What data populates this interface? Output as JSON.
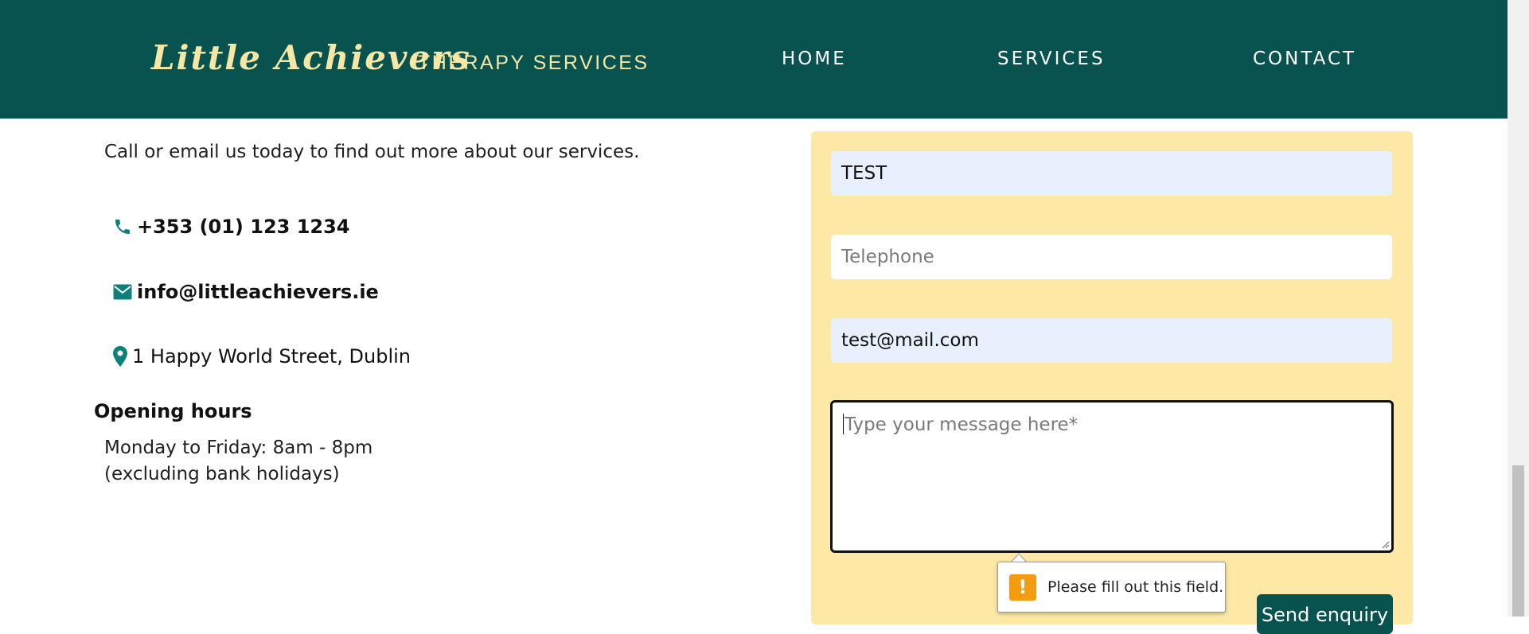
{
  "header": {
    "brand_name": "Little Achievers",
    "brand_tagline": "THERAPY SERVICES",
    "nav": [
      {
        "label": "HOME"
      },
      {
        "label": "SERVICES"
      },
      {
        "label": "CONTACT"
      }
    ]
  },
  "contact_info": {
    "intro": "Call or email us today to find out more about our services.",
    "phone": {
      "icon": "phone-icon",
      "text": "+353 (01) 123 1234"
    },
    "email": {
      "icon": "envelope-icon",
      "text": "info@littleachievers.ie"
    },
    "address": {
      "icon": "map-pin-icon",
      "text": "1 Happy World Street, Dublin"
    },
    "hours_heading": "Opening hours",
    "hours_line1": "Monday to Friday: 8am - 8pm",
    "hours_line2": "(excluding bank holidays)"
  },
  "form": {
    "name": {
      "value": "TEST",
      "placeholder": ""
    },
    "telephone": {
      "value": "",
      "placeholder": "Telephone"
    },
    "email": {
      "value": "test@mail.com",
      "placeholder": ""
    },
    "message": {
      "value": "",
      "placeholder": "Type your message here*"
    },
    "submit_label": "Send enquiry",
    "validation_message": "Please fill out this field."
  },
  "colors": {
    "header_bg": "#08524f",
    "brand_text": "#f7e7a4",
    "form_bg": "#fde8a6",
    "autofill_bg": "#e8f0fe",
    "icon_teal": "#0e7f7a",
    "warning": "#f39c12"
  }
}
